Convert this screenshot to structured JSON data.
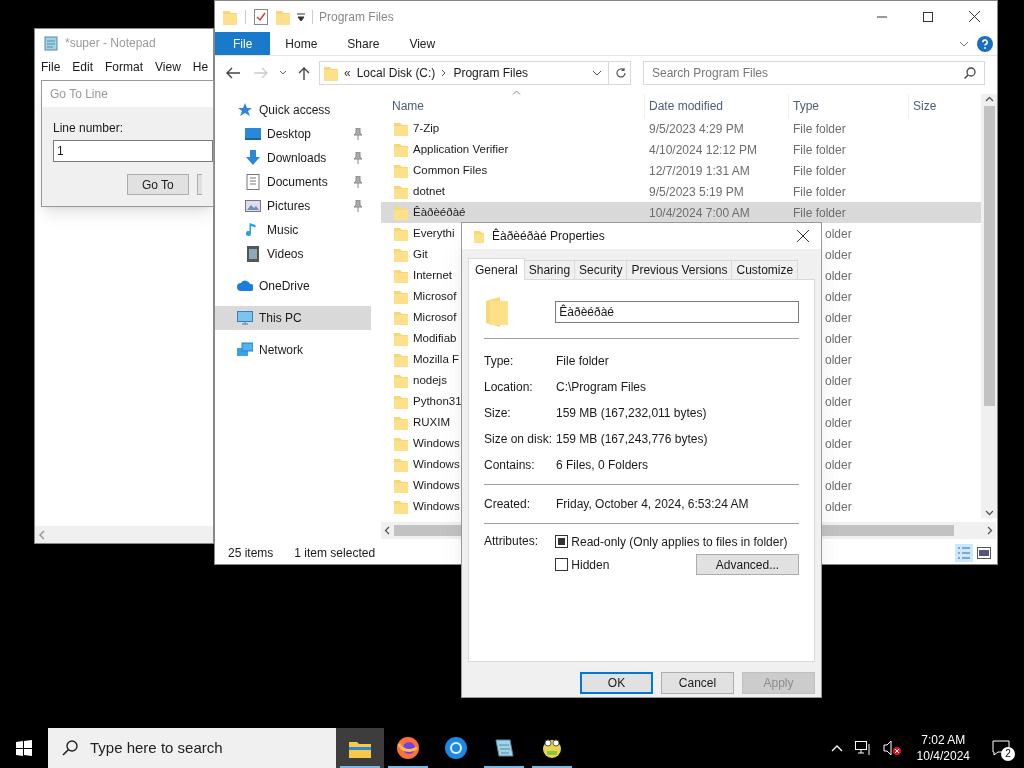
{
  "notepad": {
    "title": "*super - Notepad",
    "menu": [
      "File",
      "Edit",
      "Format",
      "View",
      "He"
    ]
  },
  "goto_dialog": {
    "title": "Go To Line",
    "label": "Line number:",
    "value": "1",
    "button": "Go To"
  },
  "explorer": {
    "title": "Program Files",
    "ribbon_tabs": [
      {
        "label": "File",
        "selected": true
      },
      {
        "label": "Home",
        "selected": false
      },
      {
        "label": "Share",
        "selected": false
      },
      {
        "label": "View",
        "selected": false
      }
    ],
    "address_overflow": "«",
    "address": [
      "Local Disk (C:)",
      "Program Files"
    ],
    "search": {
      "placeholder": "Search Program Files"
    },
    "sidebar": [
      {
        "label": "Quick access",
        "kind": "star",
        "selected": false,
        "children": [
          {
            "label": "Desktop",
            "kind": "desktop",
            "pinned": true,
            "selected": false
          },
          {
            "label": "Downloads",
            "kind": "download",
            "pinned": true,
            "selected": false
          },
          {
            "label": "Documents",
            "kind": "document",
            "pinned": true,
            "selected": false
          },
          {
            "label": "Pictures",
            "kind": "picture",
            "pinned": true,
            "selected": false
          },
          {
            "label": "Music",
            "kind": "music",
            "pinned": false,
            "selected": false
          },
          {
            "label": "Videos",
            "kind": "video",
            "pinned": false,
            "selected": false
          }
        ]
      },
      {
        "label": "OneDrive",
        "kind": "cloud",
        "selected": false
      },
      {
        "label": "This PC",
        "kind": "pc",
        "selected": true
      },
      {
        "label": "Network",
        "kind": "network",
        "selected": false
      }
    ],
    "columns": [
      "Name",
      "Date modified",
      "Type",
      "Size"
    ],
    "rows": [
      {
        "name": "7-Zip",
        "date": "9/5/2023 4:29 PM",
        "type": "File folder",
        "selected": false
      },
      {
        "name": "Application Verifier",
        "date": "4/10/2024 12:12 PM",
        "type": "File folder",
        "selected": false
      },
      {
        "name": "Common Files",
        "date": "12/7/2019 1:31 AM",
        "type": "File folder",
        "selected": false
      },
      {
        "name": "dotnet",
        "date": "9/5/2023 5:19 PM",
        "type": "File folder",
        "selected": false
      },
      {
        "name": "Êàðèéðàé",
        "date": "10/4/2024 7:00 AM",
        "type": "File folder",
        "selected": true
      },
      {
        "name": "Everythi",
        "type": "older",
        "selected": false
      },
      {
        "name": "Git",
        "type": "older",
        "selected": false
      },
      {
        "name": "Internet",
        "type": "older",
        "selected": false
      },
      {
        "name": "Microsof",
        "type": "older",
        "selected": false
      },
      {
        "name": "Microsof",
        "type": "older",
        "selected": false
      },
      {
        "name": "Modifiab",
        "type": "older",
        "selected": false
      },
      {
        "name": "Mozilla F",
        "type": "older",
        "selected": false
      },
      {
        "name": "nodejs",
        "type": "older",
        "selected": false
      },
      {
        "name": "Python31",
        "type": "older",
        "selected": false
      },
      {
        "name": "RUXIM",
        "type": "older",
        "selected": false
      },
      {
        "name": "Windows",
        "type": "older",
        "selected": false
      },
      {
        "name": "Windows",
        "type": "older",
        "selected": false
      },
      {
        "name": "Windows",
        "type": "older",
        "selected": false
      },
      {
        "name": "Windows",
        "type": "older",
        "selected": false
      }
    ],
    "status": {
      "count": "25 items",
      "selection": "1 item selected"
    }
  },
  "properties": {
    "title": "Êàðèéðàé Properties",
    "tabs": [
      {
        "label": "General",
        "selected": true
      },
      {
        "label": "Sharing",
        "selected": false
      },
      {
        "label": "Security",
        "selected": false
      },
      {
        "label": "Previous Versions",
        "selected": false
      },
      {
        "label": "Customize",
        "selected": false
      }
    ],
    "name_value": "Êàðèéðàé",
    "details": [
      {
        "label": "Type:",
        "value": "File folder"
      },
      {
        "label": "Location:",
        "value": "C:\\Program Files"
      },
      {
        "label": "Size:",
        "value": "159 MB (167,232,011 bytes)"
      },
      {
        "label": "Size on disk:",
        "value": "159 MB (167,243,776 bytes)"
      },
      {
        "label": "Contains:",
        "value": "6 Files, 0 Folders"
      }
    ],
    "created": {
      "label": "Created:",
      "value": "Friday, October 4, 2024, 6:53:24 AM"
    },
    "attributes": {
      "label": "Attributes:",
      "items": [
        {
          "label": "Read-only (Only applies to files in folder)",
          "indeterminate": true
        },
        {
          "label": "Hidden",
          "checked": false,
          "indeterminate": false
        }
      ],
      "advanced": "Advanced..."
    },
    "buttons": [
      {
        "label": "OK",
        "default": true,
        "disabled": false
      },
      {
        "label": "Cancel",
        "default": false,
        "disabled": false
      },
      {
        "label": "Apply",
        "default": false,
        "disabled": true
      }
    ]
  },
  "taskbar": {
    "search_placeholder": "Type here to search",
    "apps": [
      {
        "kind": "folder",
        "active": true,
        "running": true
      },
      {
        "kind": "fox",
        "active": false,
        "running": true
      },
      {
        "kind": "ring",
        "active": false,
        "running": false
      },
      {
        "kind": "notepad",
        "active": false,
        "running": true
      },
      {
        "kind": "frog",
        "active": false,
        "running": true
      }
    ],
    "time": "7:02 AM",
    "date": "10/4/2024",
    "notifications": "2"
  }
}
